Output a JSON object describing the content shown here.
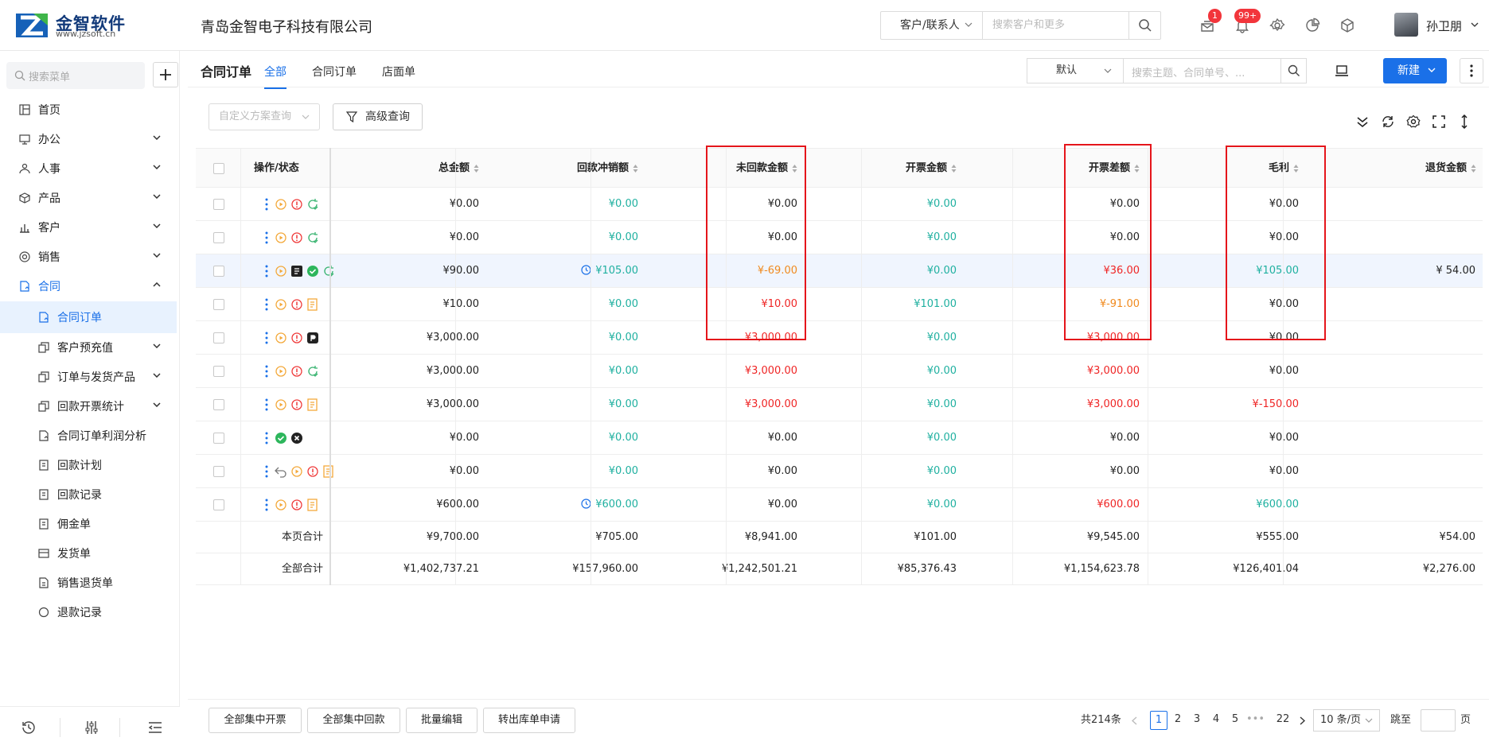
{
  "topbar": {
    "logo_name": "金智软件",
    "logo_url": "www.jzsoft.cn",
    "company": "青岛金智电子科技有限公司",
    "search_select": "客户/联系人",
    "search_placeholder": "搜索客户和更多",
    "msg_badge": "1",
    "bell_badge": "99+",
    "user_name": "孙卫朋"
  },
  "sidebar": {
    "search_placeholder": "搜索菜单",
    "items": [
      {
        "label": "首页"
      },
      {
        "label": "办公"
      },
      {
        "label": "人事"
      },
      {
        "label": "产品"
      },
      {
        "label": "客户"
      },
      {
        "label": "销售"
      },
      {
        "label": "合同"
      },
      {
        "label": "合同订单"
      },
      {
        "label": "客户预充值"
      },
      {
        "label": "订单与发货产品"
      },
      {
        "label": "回款开票统计"
      },
      {
        "label": "合同订单利润分析"
      },
      {
        "label": "回款计划"
      },
      {
        "label": "回款记录"
      },
      {
        "label": "佣金单"
      },
      {
        "label": "发货单"
      },
      {
        "label": "销售退货单"
      },
      {
        "label": "退款记录"
      }
    ]
  },
  "header": {
    "title": "合同订单",
    "tabs": [
      "全部",
      "合同订单",
      "店面单"
    ],
    "view_select": "默认",
    "search_placeholder": "搜索主题、合同单号、...",
    "new_button": "新建"
  },
  "filters": {
    "query_placeholder": "自定义方案查询",
    "advanced": "高级查询"
  },
  "table": {
    "columns": [
      "操作/状态",
      "总金额",
      "回款冲销额",
      "未回款金额",
      "开票金额",
      "开票差额",
      "毛利",
      "退货金额"
    ],
    "rows": [
      {
        "total": "¥0.00",
        "writeoff": "¥0.00",
        "unpaid": "¥0.00",
        "invoiced": "¥0.00",
        "invdiff": "¥0.00",
        "profit": "¥0.00",
        "returns": ""
      },
      {
        "total": "¥0.00",
        "writeoff": "¥0.00",
        "unpaid": "¥0.00",
        "invoiced": "¥0.00",
        "invdiff": "¥0.00",
        "profit": "¥0.00",
        "returns": ""
      },
      {
        "total": "¥90.00",
        "writeoff": "¥105.00",
        "unpaid": "¥-69.00",
        "invoiced": "¥0.00",
        "invdiff": "¥36.00",
        "profit": "¥105.00",
        "returns": "¥ 54.00"
      },
      {
        "total": "¥10.00",
        "writeoff": "¥0.00",
        "unpaid": "¥10.00",
        "invoiced": "¥101.00",
        "invdiff": "¥-91.00",
        "profit": "¥0.00",
        "returns": ""
      },
      {
        "total": "¥3,000.00",
        "writeoff": "¥0.00",
        "unpaid": "¥3,000.00",
        "invoiced": "¥0.00",
        "invdiff": "¥3,000.00",
        "profit": "¥0.00",
        "returns": ""
      },
      {
        "total": "¥3,000.00",
        "writeoff": "¥0.00",
        "unpaid": "¥3,000.00",
        "invoiced": "¥0.00",
        "invdiff": "¥3,000.00",
        "profit": "¥0.00",
        "returns": ""
      },
      {
        "total": "¥3,000.00",
        "writeoff": "¥0.00",
        "unpaid": "¥3,000.00",
        "invoiced": "¥0.00",
        "invdiff": "¥3,000.00",
        "profit": "¥-150.00",
        "returns": ""
      },
      {
        "total": "¥0.00",
        "writeoff": "¥0.00",
        "unpaid": "¥0.00",
        "invoiced": "¥0.00",
        "invdiff": "¥0.00",
        "profit": "¥0.00",
        "returns": ""
      },
      {
        "total": "¥0.00",
        "writeoff": "¥0.00",
        "unpaid": "¥0.00",
        "invoiced": "¥0.00",
        "invdiff": "¥0.00",
        "profit": "¥0.00",
        "returns": ""
      },
      {
        "total": "¥600.00",
        "writeoff": "¥600.00",
        "unpaid": "¥0.00",
        "invoiced": "¥0.00",
        "invdiff": "¥600.00",
        "profit": "¥600.00",
        "returns": ""
      }
    ],
    "page_total": {
      "label": "本页合计",
      "total": "¥9,700.00",
      "writeoff": "¥705.00",
      "unpaid": "¥8,941.00",
      "invoiced": "¥101.00",
      "invdiff": "¥9,545.00",
      "profit": "¥555.00",
      "returns": "¥54.00"
    },
    "all_total": {
      "label": "全部合计",
      "total": "¥1,402,737.21",
      "writeoff": "¥157,960.00",
      "unpaid": "¥1,242,501.21",
      "invoiced": "¥85,376.43",
      "invdiff": "¥1,154,623.78",
      "profit": "¥126,401.04",
      "returns": "¥2,276.00"
    }
  },
  "footer": {
    "buttons": [
      "全部集中开票",
      "全部集中回款",
      "批量编辑",
      "转出库单申请"
    ],
    "total_count": "共214条",
    "pages": [
      "1",
      "2",
      "3",
      "4",
      "5",
      "•••",
      "22"
    ],
    "page_size": "10 条/页",
    "jump_label": "跳至",
    "page_unit": "页"
  }
}
